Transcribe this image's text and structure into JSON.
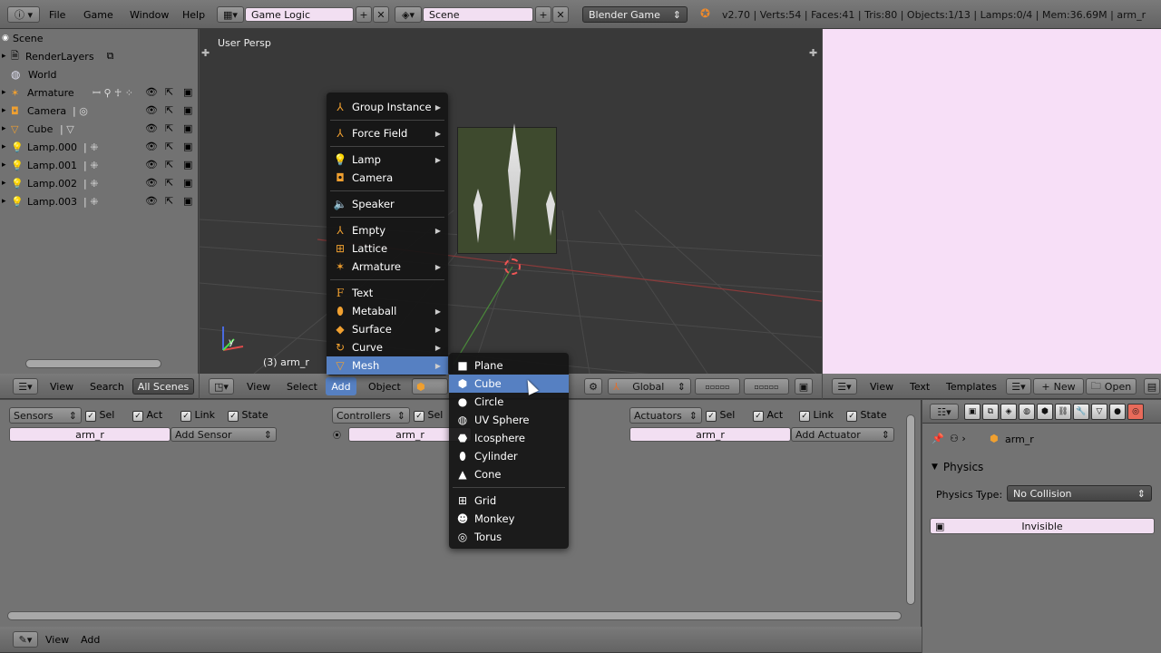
{
  "topbar": {
    "menus": [
      "File",
      "Game",
      "Window",
      "Help"
    ],
    "screen_layout": "Game Logic",
    "scene": "Scene",
    "engine": "Blender Game",
    "stats": "v2.70 | Verts:54 | Faces:41 | Tris:80 | Objects:1/13 | Lamps:0/4 | Mem:36.69M | arm_r"
  },
  "outliner": {
    "items": [
      {
        "label": "Scene"
      },
      {
        "label": "RenderLayers"
      },
      {
        "label": "World"
      },
      {
        "label": "Armature"
      },
      {
        "label": "Camera"
      },
      {
        "label": "Cube"
      },
      {
        "label": "Lamp.000"
      },
      {
        "label": "Lamp.001"
      },
      {
        "label": "Lamp.002"
      },
      {
        "label": "Lamp.003"
      }
    ],
    "footer": [
      "View",
      "Search",
      "All Scenes"
    ]
  },
  "viewport": {
    "label": "User Persp",
    "object_info": "(3) arm_r",
    "header": [
      "View",
      "Select",
      "Add",
      "Object"
    ],
    "orientation": "Global"
  },
  "text_editor": {
    "header": [
      "View",
      "Text",
      "Templates"
    ],
    "new_label": "New",
    "open_label": "Open"
  },
  "add_menu": {
    "items": [
      "Group Instance",
      "Force Field",
      "Lamp",
      "Camera",
      "Speaker",
      "Empty",
      "Lattice",
      "Armature",
      "Text",
      "Metaball",
      "Surface",
      "Curve",
      "Mesh"
    ]
  },
  "mesh_menu": {
    "items": [
      "Plane",
      "Cube",
      "Circle",
      "UV Sphere",
      "Icosphere",
      "Cylinder",
      "Cone",
      "Grid",
      "Monkey",
      "Torus"
    ]
  },
  "logic": {
    "sensors": "Sensors",
    "controllers": "Controllers",
    "actuators": "Actuators",
    "sel": "Sel",
    "act": "Act",
    "link": "Link",
    "state": "State",
    "object_name": "arm_r",
    "add_sensor": "Add Sensor",
    "add_actuator": "Add Actuator",
    "footer": [
      "View",
      "Add"
    ]
  },
  "properties": {
    "object_name": "arm_r",
    "panel_title": "Physics",
    "physics_type_label": "Physics Type:",
    "physics_type_value": "No Collision",
    "invisible_label": "Invisible"
  }
}
